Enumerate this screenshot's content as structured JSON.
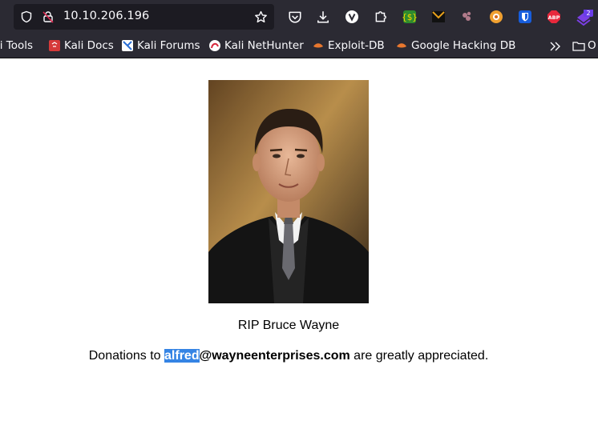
{
  "browser": {
    "url": "10.10.206.196",
    "extension_badge_count": "2",
    "abp_label": "ABP",
    "bookmarks": [
      {
        "label": "li Tools",
        "icon": "kali-icon"
      },
      {
        "label": "Kali Docs",
        "icon": "kali-docs-icon"
      },
      {
        "label": "Kali Forums",
        "icon": "kali-forums-icon"
      },
      {
        "label": "Kali NetHunter",
        "icon": "kali-nethunter-icon"
      },
      {
        "label": "Exploit-DB",
        "icon": "exploit-db-icon"
      },
      {
        "label": "Google Hacking DB",
        "icon": "ghdb-icon"
      }
    ],
    "other_bookmarks_label": "O"
  },
  "page": {
    "photo_alt": "portrait-photo",
    "caption": "RIP Bruce Wayne",
    "donation": {
      "prefix": "Donations to ",
      "email_user": "alfred",
      "email_domain": "@wayneenterprises.com",
      "suffix": " are greatly appreciated."
    }
  },
  "colors": {
    "chrome_bg": "#2b2a33",
    "urlbar_bg": "#1c1b22",
    "selection": "#3584e4"
  }
}
